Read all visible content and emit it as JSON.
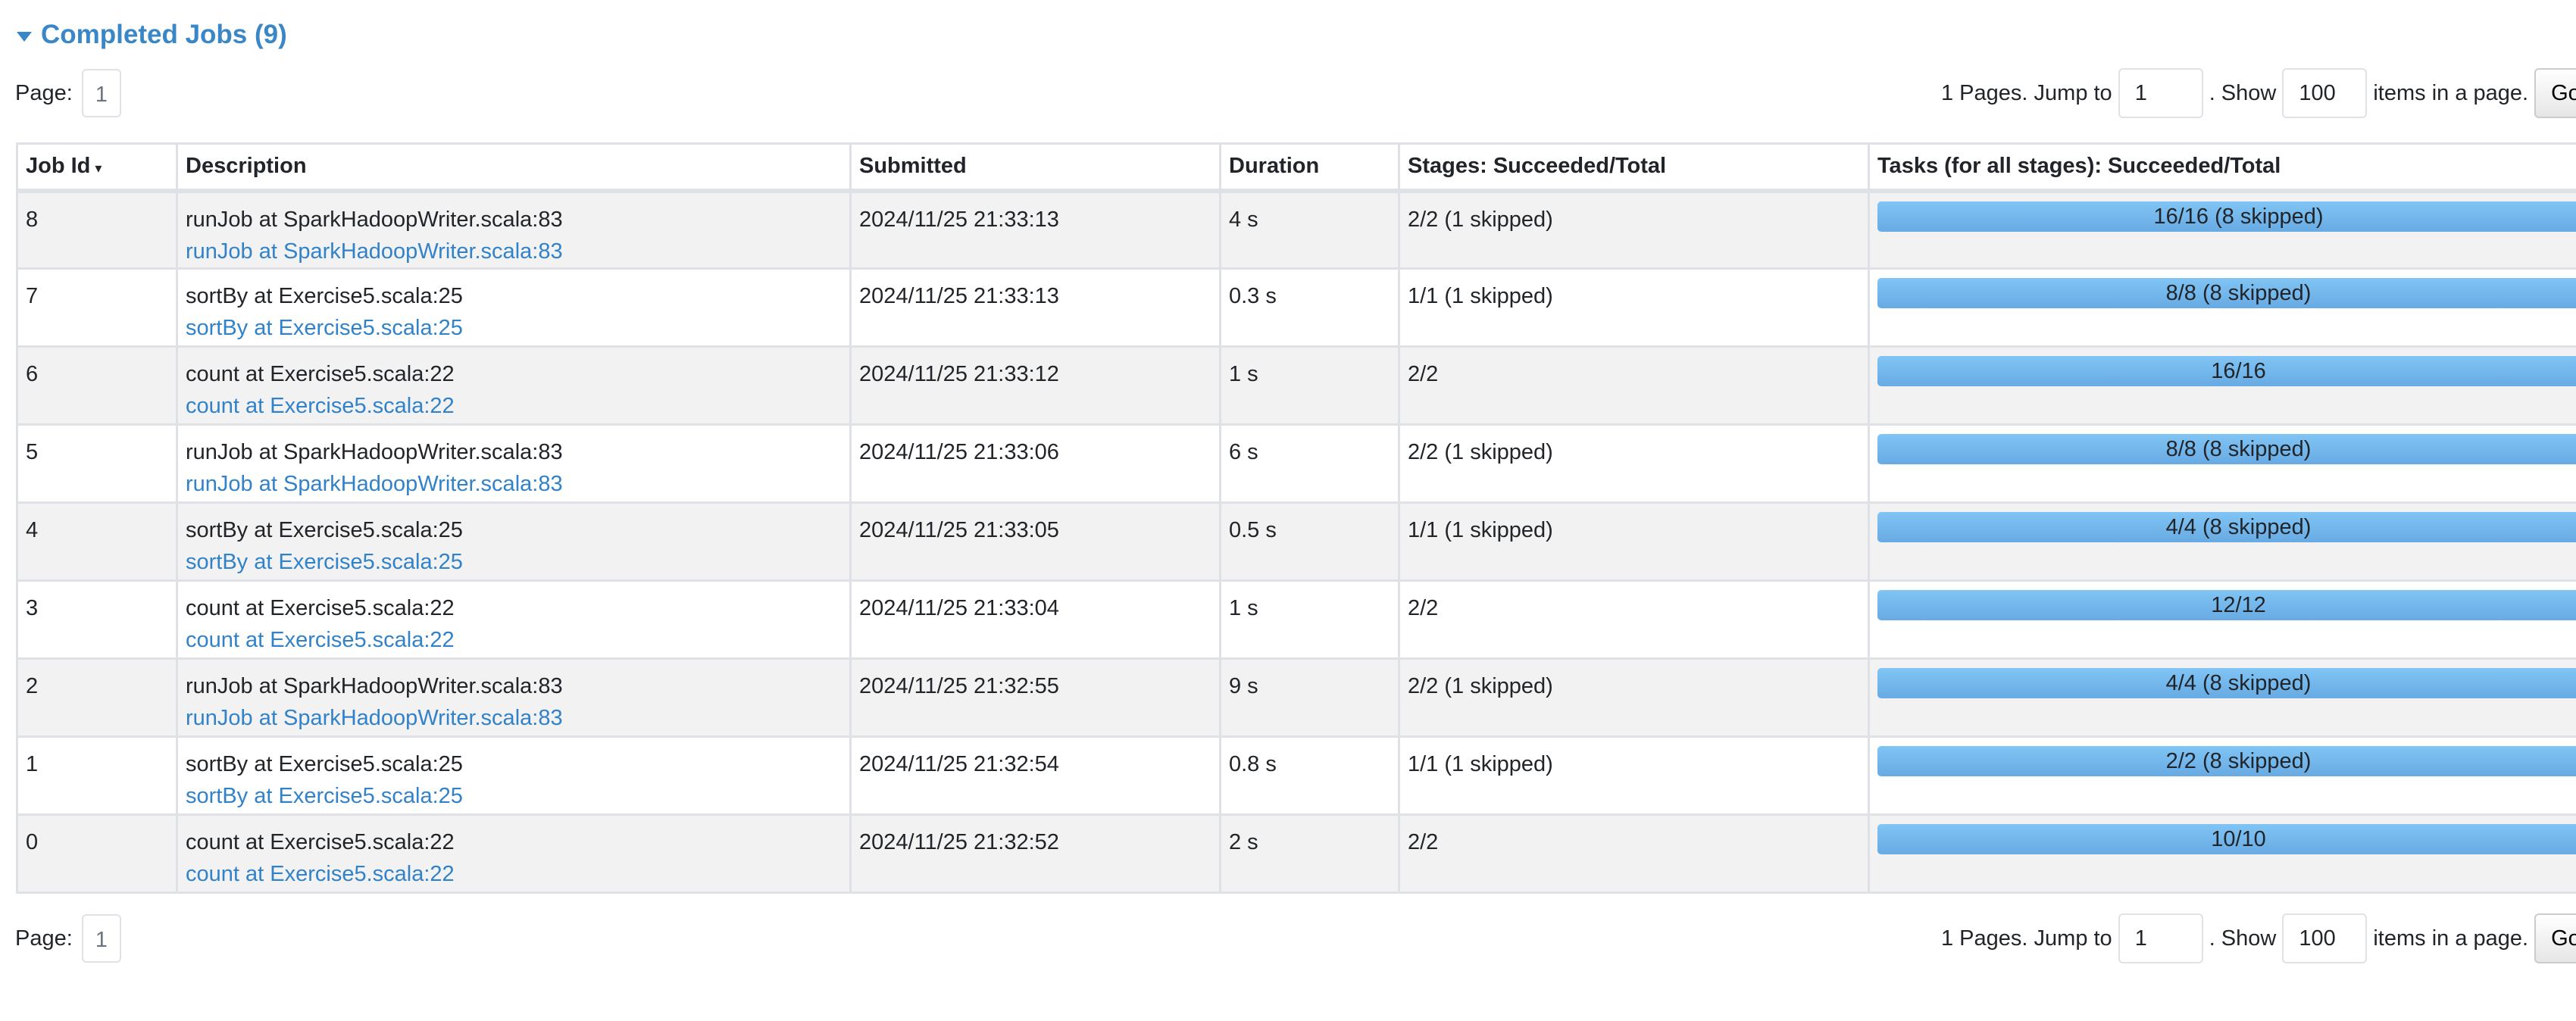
{
  "section": {
    "title": "Completed Jobs (9)"
  },
  "pager": {
    "page_label": "Page:",
    "current_page": "1",
    "pages_text": "1 Pages. Jump to",
    "jump_value": "1",
    "show_text": ". Show",
    "show_value": "100",
    "items_text": "items in a page.",
    "go_label": "Go"
  },
  "table": {
    "headers": [
      "Job Id",
      "Description",
      "Submitted",
      "Duration",
      "Stages: Succeeded/Total",
      "Tasks (for all stages): Succeeded/Total"
    ],
    "sort_indicator": "▾",
    "rows": [
      {
        "id": "8",
        "desc": "runJob at SparkHadoopWriter.scala:83",
        "link": "runJob at SparkHadoopWriter.scala:83",
        "submitted": "2024/11/25 21:33:13",
        "duration": "4 s",
        "stages": "2/2 (1 skipped)",
        "tasks": "16/16 (8 skipped)",
        "progress": 1.0
      },
      {
        "id": "7",
        "desc": "sortBy at Exercise5.scala:25",
        "link": "sortBy at Exercise5.scala:25",
        "submitted": "2024/11/25 21:33:13",
        "duration": "0.3 s",
        "stages": "1/1 (1 skipped)",
        "tasks": "8/8 (8 skipped)",
        "progress": 1.0
      },
      {
        "id": "6",
        "desc": "count at Exercise5.scala:22",
        "link": "count at Exercise5.scala:22",
        "submitted": "2024/11/25 21:33:12",
        "duration": "1 s",
        "stages": "2/2",
        "tasks": "16/16",
        "progress": 1.0
      },
      {
        "id": "5",
        "desc": "runJob at SparkHadoopWriter.scala:83",
        "link": "runJob at SparkHadoopWriter.scala:83",
        "submitted": "2024/11/25 21:33:06",
        "duration": "6 s",
        "stages": "2/2 (1 skipped)",
        "tasks": "8/8 (8 skipped)",
        "progress": 1.0
      },
      {
        "id": "4",
        "desc": "sortBy at Exercise5.scala:25",
        "link": "sortBy at Exercise5.scala:25",
        "submitted": "2024/11/25 21:33:05",
        "duration": "0.5 s",
        "stages": "1/1 (1 skipped)",
        "tasks": "4/4 (8 skipped)",
        "progress": 1.0
      },
      {
        "id": "3",
        "desc": "count at Exercise5.scala:22",
        "link": "count at Exercise5.scala:22",
        "submitted": "2024/11/25 21:33:04",
        "duration": "1 s",
        "stages": "2/2",
        "tasks": "12/12",
        "progress": 1.0
      },
      {
        "id": "2",
        "desc": "runJob at SparkHadoopWriter.scala:83",
        "link": "runJob at SparkHadoopWriter.scala:83",
        "submitted": "2024/11/25 21:32:55",
        "duration": "9 s",
        "stages": "2/2 (1 skipped)",
        "tasks": "4/4 (8 skipped)",
        "progress": 1.0
      },
      {
        "id": "1",
        "desc": "sortBy at Exercise5.scala:25",
        "link": "sortBy at Exercise5.scala:25",
        "submitted": "2024/11/25 21:32:54",
        "duration": "0.8 s",
        "stages": "1/1 (1 skipped)",
        "tasks": "2/2 (8 skipped)",
        "progress": 1.0
      },
      {
        "id": "0",
        "desc": "count at Exercise5.scala:22",
        "link": "count at Exercise5.scala:22",
        "submitted": "2024/11/25 21:32:52",
        "duration": "2 s",
        "stages": "2/2",
        "tasks": "10/10",
        "progress": 1.0
      }
    ]
  },
  "colors": {
    "accent": "#3a87c8",
    "link": "#3282c9",
    "bar": "#68aae3",
    "stripe": "#f2f2f2"
  }
}
